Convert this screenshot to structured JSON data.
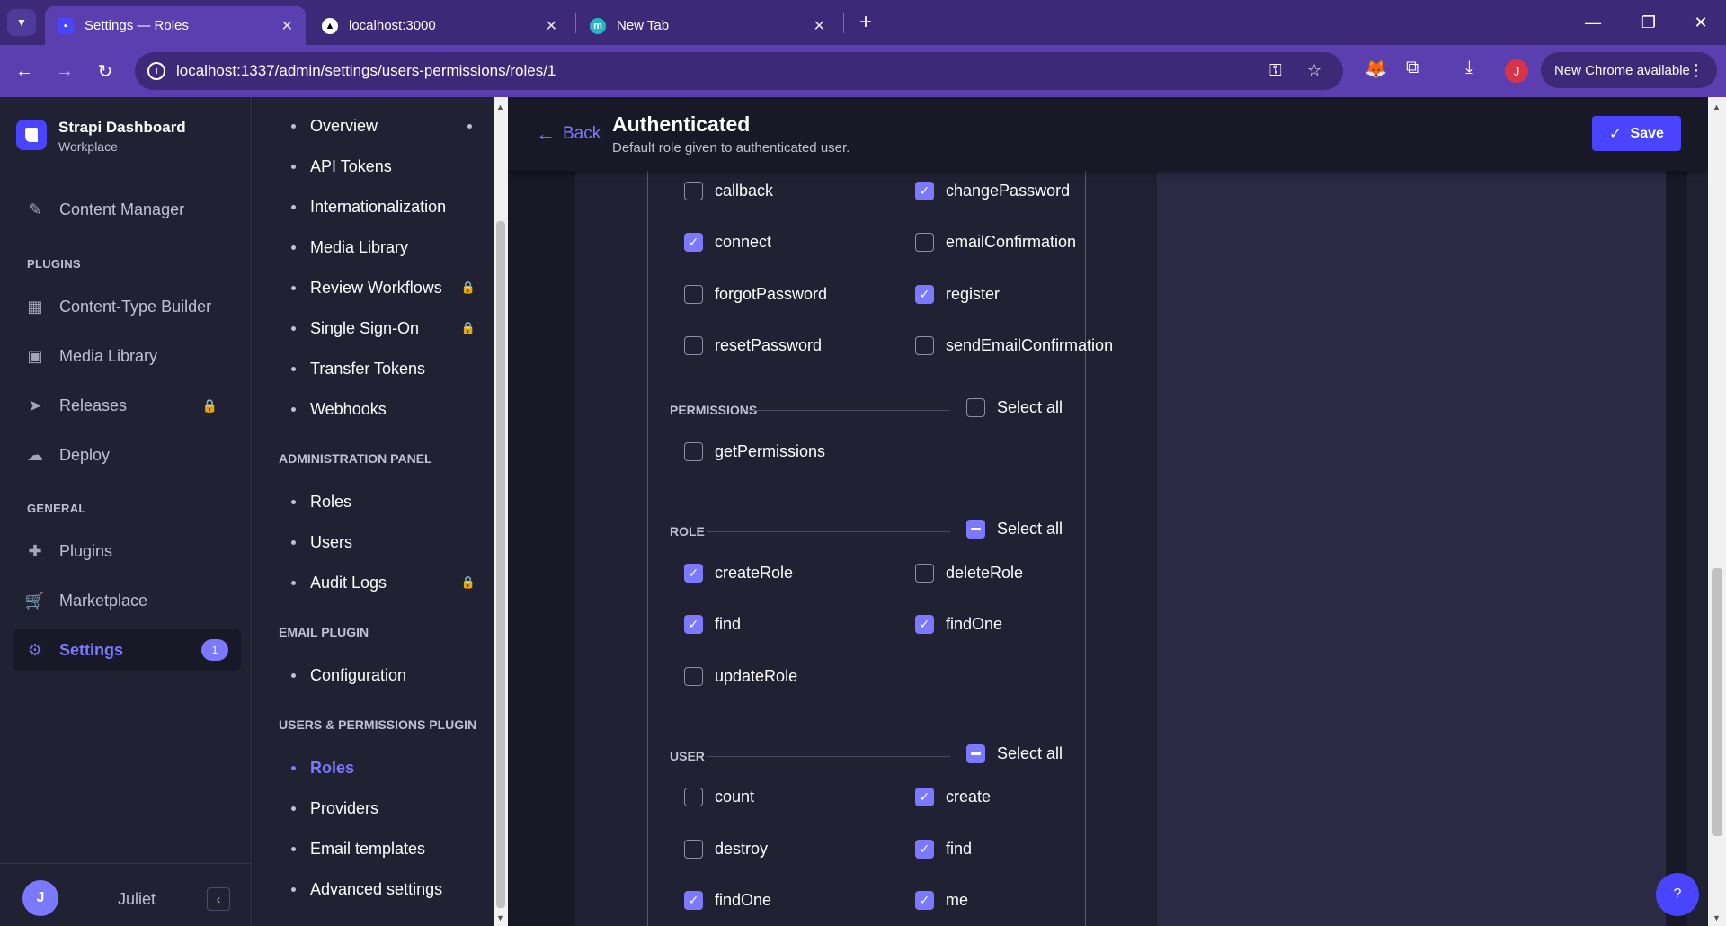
{
  "browser": {
    "tabs": [
      {
        "title": "Settings — Roles",
        "active": true
      },
      {
        "title": "localhost:3000",
        "active": false
      },
      {
        "title": "New Tab",
        "active": false
      }
    ],
    "url": "localhost:1337/admin/settings/users-permissions/roles/1",
    "profile_initial": "J",
    "update_label": "New Chrome available"
  },
  "mainnav": {
    "brand_name": "Strapi Dashboard",
    "brand_workspace": "Workplace",
    "content_manager": "Content Manager",
    "plugins_title": "PLUGINS",
    "plugins": [
      {
        "label": "Content-Type Builder",
        "icon": "layout-icon"
      },
      {
        "label": "Media Library",
        "icon": "image-icon"
      },
      {
        "label": "Releases",
        "icon": "send-icon",
        "locked": true
      },
      {
        "label": "Deploy",
        "icon": "cloud-icon"
      }
    ],
    "general_title": "GENERAL",
    "general": [
      {
        "label": "Plugins",
        "icon": "puzzle-icon"
      },
      {
        "label": "Marketplace",
        "icon": "cart-icon"
      },
      {
        "label": "Settings",
        "icon": "gear-icon",
        "badge": "1",
        "active": true
      }
    ],
    "user_initial": "J",
    "user_name": "Juliet"
  },
  "subnav": {
    "global": [
      "Overview",
      "API Tokens",
      "Internationalization",
      "Media Library",
      "Review Workflows",
      "Single Sign-On",
      "Transfer Tokens",
      "Webhooks"
    ],
    "admin_title": "ADMINISTRATION PANEL",
    "admin": [
      "Roles",
      "Users",
      "Audit Logs"
    ],
    "email_title": "EMAIL PLUGIN",
    "email": [
      "Configuration"
    ],
    "up_title": "USERS & PERMISSIONS PLUGIN",
    "up": [
      "Roles",
      "Providers",
      "Email templates",
      "Advanced settings"
    ]
  },
  "header": {
    "back_label": "Back",
    "title": "Authenticated",
    "subtitle": "Default role given to authenticated user.",
    "save_label": "Save"
  },
  "permissions": {
    "auth_actions": [
      {
        "name": "callback",
        "checked": false
      },
      {
        "name": "changePassword",
        "checked": true
      },
      {
        "name": "connect",
        "checked": true
      },
      {
        "name": "emailConfirmation",
        "checked": false
      },
      {
        "name": "forgotPassword",
        "checked": false
      },
      {
        "name": "register",
        "checked": true
      },
      {
        "name": "resetPassword",
        "checked": false
      },
      {
        "name": "sendEmailConfirmation",
        "checked": false
      }
    ],
    "select_all_label": "Select all",
    "groups": [
      {
        "label": "PERMISSIONS",
        "select_all": "unchecked",
        "actions": [
          {
            "name": "getPermissions",
            "checked": false
          }
        ]
      },
      {
        "label": "ROLE",
        "select_all": "indeterminate",
        "actions": [
          {
            "name": "createRole",
            "checked": true
          },
          {
            "name": "deleteRole",
            "checked": false
          },
          {
            "name": "find",
            "checked": true
          },
          {
            "name": "findOne",
            "checked": true
          },
          {
            "name": "updateRole",
            "checked": false
          }
        ]
      },
      {
        "label": "USER",
        "select_all": "indeterminate",
        "actions": [
          {
            "name": "count",
            "checked": false
          },
          {
            "name": "create",
            "checked": true
          },
          {
            "name": "destroy",
            "checked": false
          },
          {
            "name": "find",
            "checked": true
          },
          {
            "name": "findOne",
            "checked": true
          },
          {
            "name": "me",
            "checked": true
          }
        ]
      }
    ]
  },
  "help_label": "?"
}
